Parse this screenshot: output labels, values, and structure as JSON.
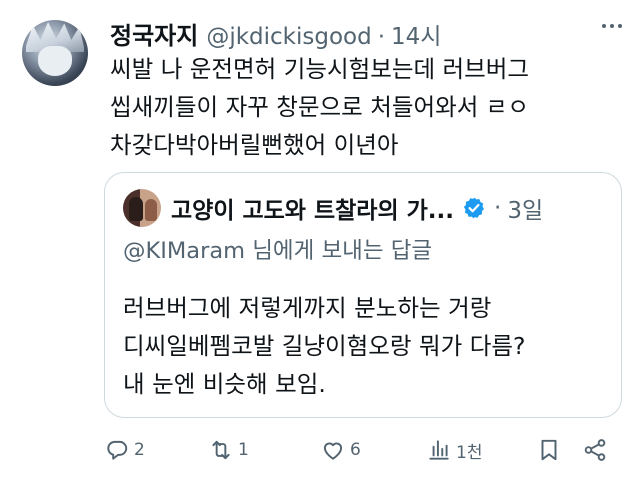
{
  "post": {
    "author": {
      "display_name": "정국자지",
      "handle": "@jkdickisgood",
      "separator": "·",
      "time": "14시"
    },
    "text_lines": [
      "씨발 나 운전면허 기능시험보는데 러브버그",
      "씹새끼들이 자꾸 창문으로 처들어와서 ㄹㅇ",
      "차갖다박아버릴뻔했어 이년아"
    ],
    "quote": {
      "display_name": "고양이 고도와 트찰라의 가...",
      "verified": true,
      "separator": "·",
      "time": "3일",
      "reply_context": "@KIMaram 님에게 보내는 답글",
      "text_lines": [
        "러브버그에 저렇게까지 분노하는 거랑",
        "디씨일베펨코발 길냥이혐오랑 뭐가 다름?",
        "내 눈엔 비슷해 보임."
      ]
    },
    "actions": {
      "replies": "2",
      "retweets": "1",
      "likes": "6",
      "views": "1천"
    },
    "icons": {
      "more": "more-dots-icon",
      "reply": "reply-icon",
      "retweet": "retweet-icon",
      "like": "heart-icon",
      "views": "views-icon",
      "bookmark": "bookmark-icon",
      "share": "share-icon",
      "verified": "verified-badge-icon"
    },
    "colors": {
      "text": "#0f1419",
      "secondary": "#536471",
      "border": "#cfd9de",
      "verified": "#1d9bf0"
    }
  }
}
